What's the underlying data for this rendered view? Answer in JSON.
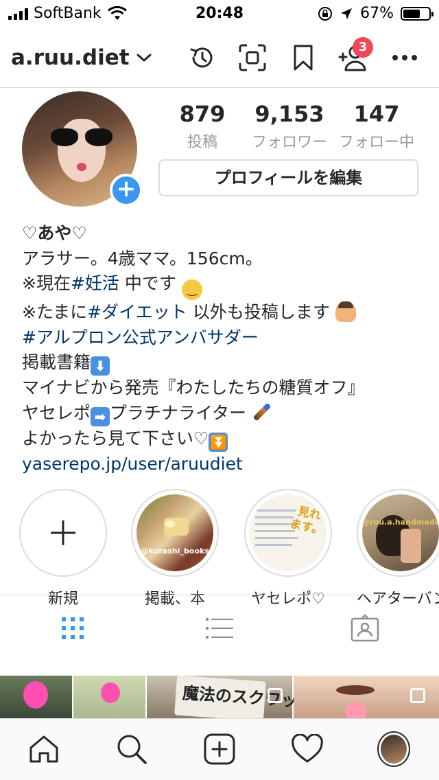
{
  "status_bar": {
    "carrier": "SoftBank",
    "time": "20:48",
    "battery_percent": "67%",
    "battery_level": 0.67,
    "icons": [
      "signal-icon",
      "wifi-icon",
      "orientation-lock-icon",
      "location-icon",
      "battery-icon"
    ]
  },
  "header": {
    "username": "a.ruu.diet",
    "notification_count": "3",
    "icons": [
      "chevron-down-icon",
      "archive-history-icon",
      "qr-scan-icon",
      "bookmark-icon",
      "add-person-icon",
      "more-icon"
    ]
  },
  "profile": {
    "posts_count": "879",
    "posts_label": "投稿",
    "followers_count": "9,153",
    "followers_label": "フォロワー",
    "following_count": "147",
    "following_label": "フォロー中",
    "edit_button_label": "プロフィールを編集",
    "add_story_symbol": "+"
  },
  "bio": {
    "name": "♡あや♡",
    "line1": "アラサー。4歳ママ。156cm。",
    "line2_prefix": "※現在",
    "line2_tag": "#妊活",
    "line2_suffix": " 中です",
    "line3_prefix": "※たまに",
    "line3_tag": "#ダイエット",
    "line3_suffix": " 以外も投稿します",
    "line4_tag": "#アルプロン公式アンバサダー",
    "line5": "掲載書籍",
    "line6": "マイナビから発売『わたしたちの糖質オフ』",
    "line7_prefix": "ヤセレポ",
    "line7_suffix": "プラチナライター",
    "line8": "よかったら見て下さい♡",
    "link": "yaserepo.jp/user/aruudiet",
    "emoji_down": "⬇",
    "emoji_right": "➡",
    "emoji_grin": "😁"
  },
  "highlights": [
    {
      "label": "新規",
      "image_text": ""
    },
    {
      "label": "掲載、本",
      "image_text": "@kurashi_books"
    },
    {
      "label": "ヤセレポ♡",
      "image_text": "見れます。"
    },
    {
      "label": "ヘアターバン",
      "image_text": "@ruu.a.handmade"
    }
  ],
  "tabs": [
    "grid-view-icon",
    "list-view-icon",
    "tagged-icon"
  ],
  "grid_thumbnail_text": "魔法のスクワット",
  "nav": [
    "home-icon",
    "search-icon",
    "new-post-icon",
    "activity-heart-icon",
    "profile-avatar"
  ],
  "colors": {
    "accent_blue": "#3897f0",
    "link_blue": "#003569",
    "badge_red": "#ed4956",
    "muted_gray": "#999999",
    "border_gray": "#dbdbdb"
  }
}
